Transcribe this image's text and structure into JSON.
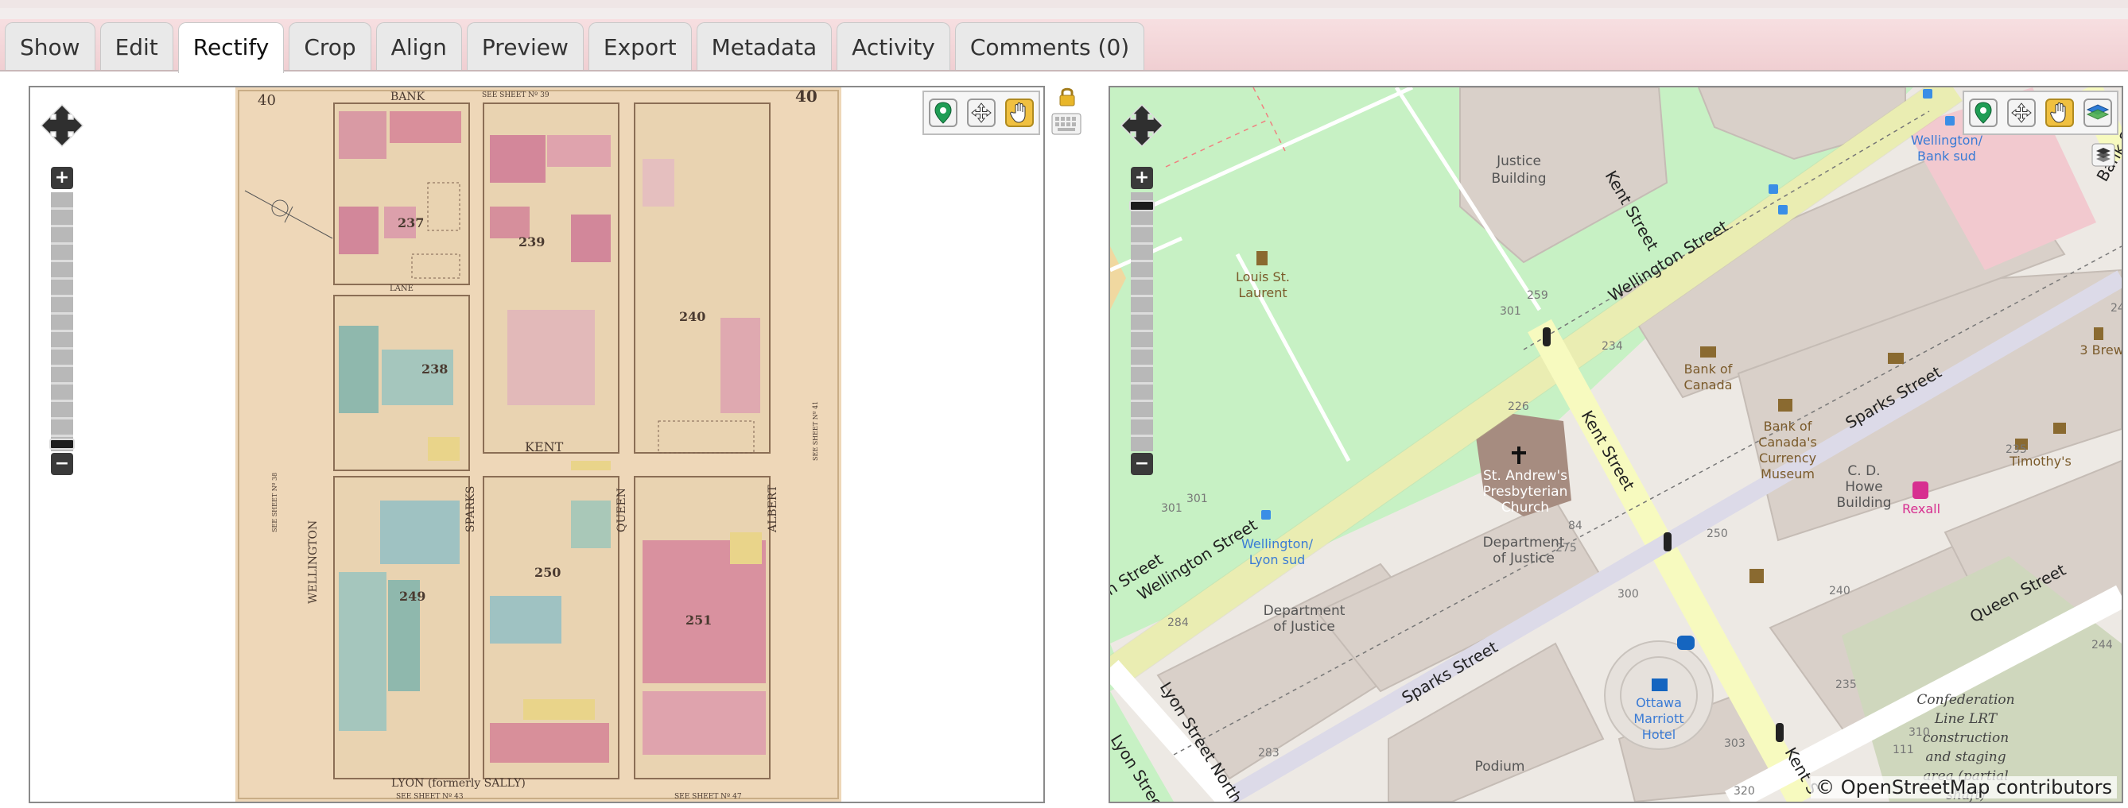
{
  "tabs": [
    {
      "label": "Show",
      "active": false
    },
    {
      "label": "Edit",
      "active": false
    },
    {
      "label": "Rectify",
      "active": true
    },
    {
      "label": "Crop",
      "active": false
    },
    {
      "label": "Align",
      "active": false
    },
    {
      "label": "Preview",
      "active": false
    },
    {
      "label": "Export",
      "active": false
    },
    {
      "label": "Metadata",
      "active": false
    },
    {
      "label": "Activity",
      "active": false
    },
    {
      "label": "Comments (0)",
      "active": false
    }
  ],
  "left_map": {
    "tools": [
      {
        "name": "add-control-point-tool",
        "icon": "map-marker-icon",
        "active": false
      },
      {
        "name": "move-control-point-tool",
        "icon": "move-arrows-icon",
        "active": false
      },
      {
        "name": "pan-tool",
        "icon": "hand-icon",
        "active": true
      }
    ],
    "side_icons": [
      "lock-icon",
      "keyboard-icon"
    ],
    "scan_labels": {
      "sheet_left": "40",
      "sheet_right": "40",
      "bank": "BANK",
      "see_sheet_top": "SEE SHEET Nº 39",
      "block_237": "237",
      "block_239": "239",
      "block_240": "240",
      "block_238": "238",
      "block_249": "249",
      "block_250": "250",
      "block_251": "251",
      "lane": "LANE",
      "kent": "KENT",
      "wellington": "WELLINGTON",
      "sparks": "SPARKS",
      "queen": "QUEEN",
      "albert": "ALBERT",
      "see_sheet_38": "SEE SHEET Nº 38",
      "see_sheet_41": "SEE SHEET Nº 41",
      "lyon": "LYON (formerly SALLY)",
      "see_sheet_bottom": "SEE SHEET Nº 43",
      "see_sheet_br": "SEE SHEET Nº 47"
    }
  },
  "right_map": {
    "tools": [
      {
        "name": "add-control-point-tool",
        "icon": "map-marker-icon",
        "active": false
      },
      {
        "name": "move-control-point-tool",
        "icon": "move-arrows-icon",
        "active": false
      },
      {
        "name": "pan-tool",
        "icon": "hand-icon",
        "active": true
      },
      {
        "name": "layer-switcher-tool",
        "icon": "layers-icon",
        "active": false
      }
    ],
    "attribution": "© OpenStreetMap contributors",
    "labels": {
      "justice_building": [
        "Justice",
        "Building"
      ],
      "louis_st_laurent": [
        "Louis St.",
        "Laurent"
      ],
      "wellington_bank_sud": [
        "Wellington/",
        "Bank sud"
      ],
      "bank_street": "Bank Street",
      "wellington_street_1": "Wellington Street",
      "wellington_street_2": "Wellington Street",
      "wellington_street_3": "n Street",
      "kent_street_1": "Kent Street",
      "kent_street_2": "Kent Street",
      "kent_street_3": "Kent S",
      "bank_of_canada": [
        "Bank of",
        "Canada"
      ],
      "currency_museum": [
        "Bank of",
        "Canada's",
        "Currency",
        "Museum"
      ],
      "sparks_street_1": "Sparks Street",
      "sparks_street_2": "Sparks Street",
      "three_brewers": "3 Brewe",
      "timothys": "Timothy's",
      "cd_howe": [
        "C. D.",
        "Howe",
        "Building"
      ],
      "rexall": "Rexall",
      "st_andrews": [
        "St. Andrew's",
        "Presbyterian",
        "Church"
      ],
      "dept_justice_1": [
        "Department",
        "of Justice"
      ],
      "dept_justice_2": [
        "Department",
        "of Justice"
      ],
      "wellington_lyon_sud": [
        "Wellington/",
        "Lyon sud"
      ],
      "queen_street": "Queen Street",
      "lyon_street_north": "Lyon Street North",
      "lyon_street_n2": "Lyon Street N",
      "ottawa_marriott": [
        "Ottawa",
        "Marriott",
        "Hotel"
      ],
      "podium": "Podium",
      "confederation": [
        "Confederation",
        "Line LRT",
        "construction",
        "and staging",
        "area (partial",
        "shaft)"
      ],
      "numbers": [
        "259",
        "301",
        "234",
        "240",
        "235",
        "226",
        "84",
        "275",
        "250",
        "300",
        "240",
        "284",
        "283",
        "303",
        "235",
        "244",
        "310",
        "111",
        "320",
        "301",
        "301"
      ]
    }
  }
}
